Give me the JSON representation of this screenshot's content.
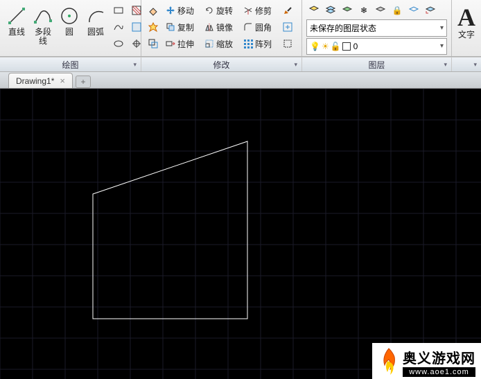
{
  "panels": {
    "draw": {
      "title": "绘图",
      "line": "直线",
      "polyline": "多段线",
      "circle": "圆",
      "arc": "圆弧"
    },
    "modify": {
      "title": "修改",
      "move": "移动",
      "copy": "复制",
      "stretch": "拉伸",
      "rotate": "旋转",
      "mirror": "镜像",
      "scale": "缩放",
      "trim": "修剪",
      "fillet": "圆角",
      "array": "阵列"
    },
    "layer": {
      "title": "图层",
      "unsaved_state": "未保存的图层状态",
      "current": "0"
    },
    "annot": {
      "title": "",
      "text": "文字",
      "A": "A"
    }
  },
  "tab": {
    "name": "Drawing1*"
  },
  "watermark": {
    "title": "奥义游戏网",
    "url": "www.aoe1.com"
  }
}
